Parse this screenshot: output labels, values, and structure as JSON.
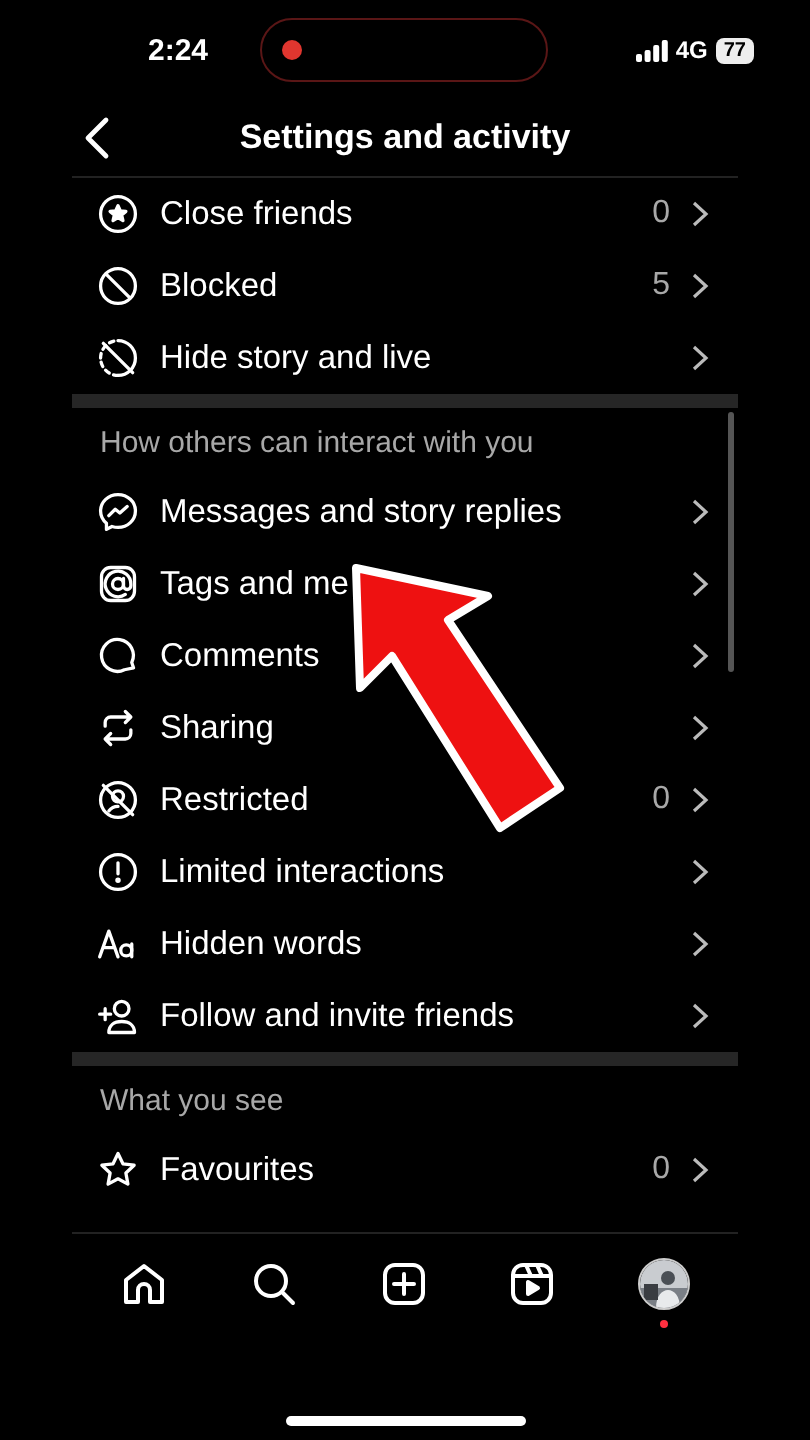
{
  "status_bar": {
    "time": "2:24",
    "network": "4G",
    "battery": "77"
  },
  "header": {
    "title": "Settings and activity"
  },
  "sections": [
    {
      "items": [
        {
          "label": "Close friends",
          "count": "0"
        },
        {
          "label": "Blocked",
          "count": "5"
        },
        {
          "label": "Hide story and live"
        }
      ]
    },
    {
      "title": "How others can interact with you",
      "items": [
        {
          "label": "Messages and story replies"
        },
        {
          "label": "Tags and me"
        },
        {
          "label": "Comments"
        },
        {
          "label": "Sharing"
        },
        {
          "label": "Restricted",
          "count": "0"
        },
        {
          "label": "Limited interactions"
        },
        {
          "label": "Hidden words"
        },
        {
          "label": "Follow and invite friends"
        }
      ]
    },
    {
      "title": "What you see",
      "items": [
        {
          "label": "Favourites",
          "count": "0"
        }
      ]
    }
  ]
}
